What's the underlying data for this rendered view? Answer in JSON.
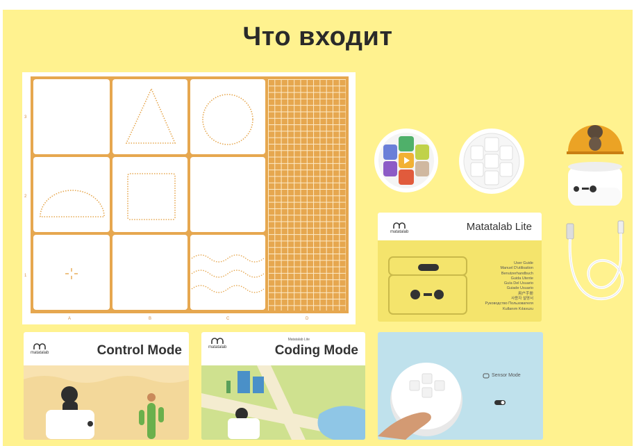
{
  "title": "Что входит",
  "mat": {
    "row_labels": [
      "3",
      "2",
      "1"
    ],
    "col_labels": [
      "A",
      "B",
      "C",
      "D"
    ]
  },
  "manual": {
    "brand": "matatalab",
    "title": "Matatalab Lite",
    "languages": [
      "User Guide",
      "Manuel D'utilisation",
      "Benutzerhandbuch",
      "Guida Utente",
      "Guía Del Usuario",
      "Guiade Usuario",
      "用户手册",
      "사용자 설명서",
      "Руководство Пользователя",
      "Kullanım Kılavuzu"
    ]
  },
  "cards": {
    "control": {
      "brand": "matatalab",
      "title": "Control Mode"
    },
    "coding": {
      "brand": "matatalab",
      "subtitle": "Matatalab Lite",
      "title": "Coding Mode"
    },
    "sensor": {
      "label": "Sensor Mode"
    }
  },
  "colors": {
    "panel": "#fff28f",
    "mat_orange": "#e6a74f",
    "robot_dome": "#e99a1a"
  }
}
